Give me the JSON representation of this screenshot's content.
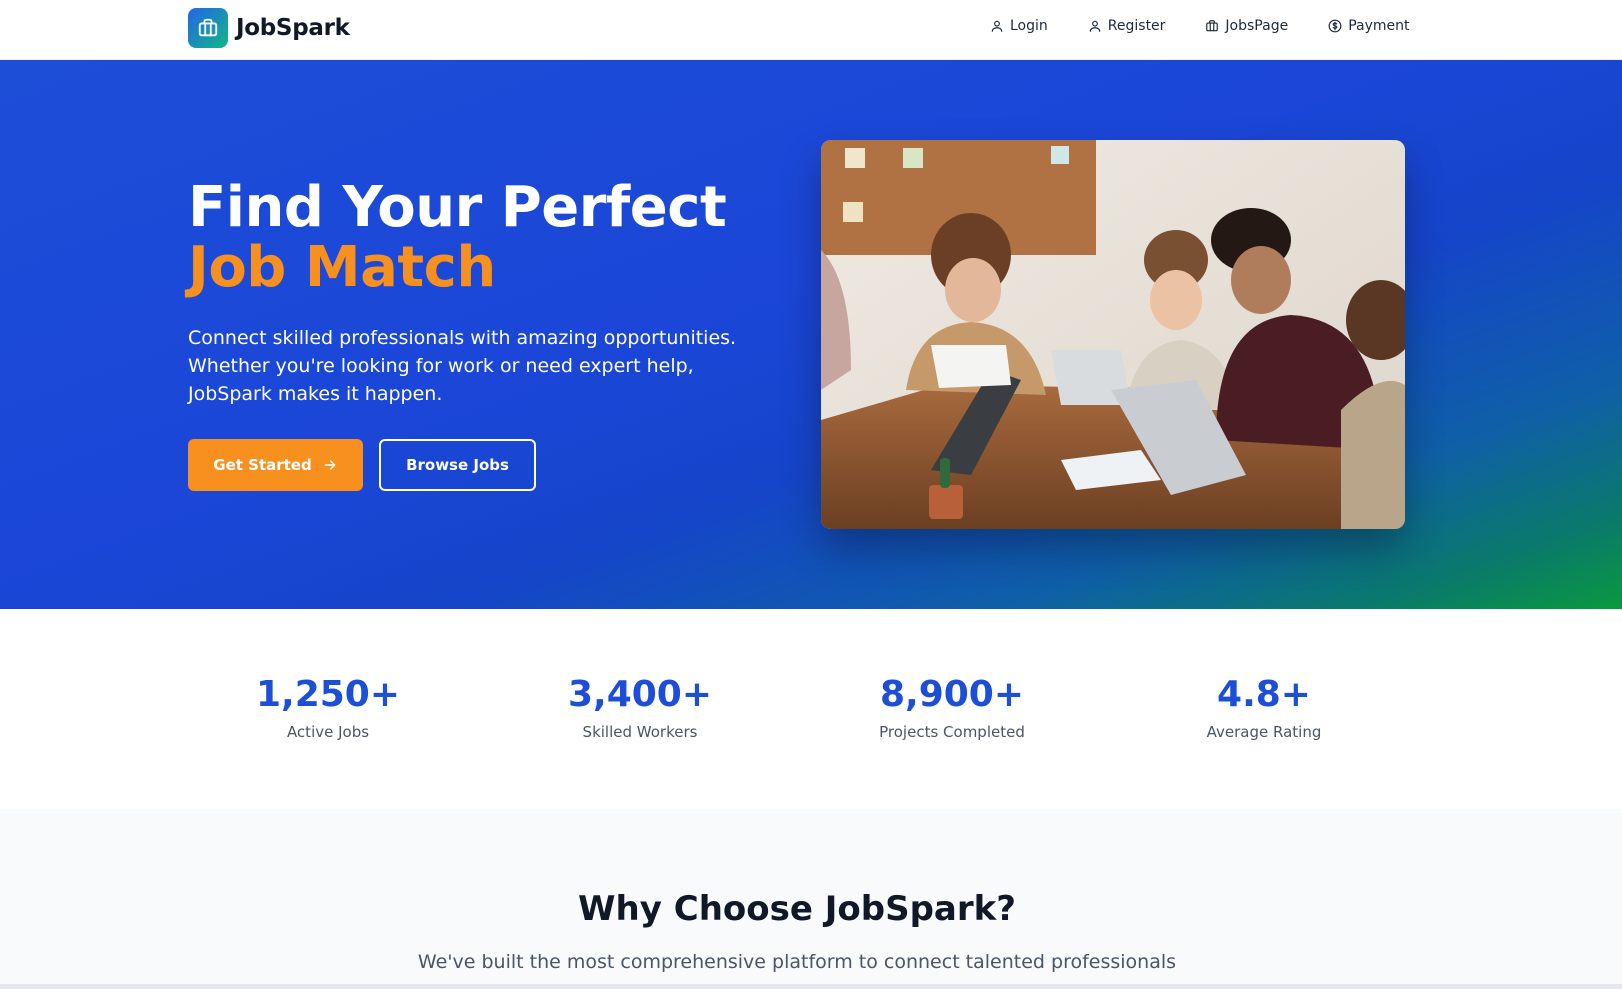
{
  "brand": {
    "name": "JobSpark"
  },
  "nav": {
    "items": [
      {
        "label": "Login",
        "icon": "user-icon"
      },
      {
        "label": "Register",
        "icon": "user-icon"
      },
      {
        "label": "JobsPage",
        "icon": "briefcase-icon"
      },
      {
        "label": "Payment",
        "icon": "dollar-circle-icon"
      }
    ]
  },
  "hero": {
    "title_line1": "Find Your Perfect",
    "title_line2": "Job Match",
    "subtitle": "Connect skilled professionals with amazing opportunities. Whether you're looking for work or need expert help, JobSpark makes it happen.",
    "cta_primary": "Get Started",
    "cta_secondary": "Browse Jobs",
    "image_alt": "team-meeting-photo"
  },
  "stats": [
    {
      "value": "1,250+",
      "label": "Active Jobs"
    },
    {
      "value": "3,400+",
      "label": "Skilled Workers"
    },
    {
      "value": "8,900+",
      "label": "Projects Completed"
    },
    {
      "value": "4.8+",
      "label": "Average Rating"
    }
  ],
  "why": {
    "title": "Why Choose JobSpark?",
    "subtitle": "We've built the most comprehensive platform to connect talented professionals with meaningful opportunities."
  },
  "colors": {
    "primary_blue": "#1d4ed8",
    "accent_orange": "#f7901e",
    "gradient_green": "#0a9940"
  }
}
